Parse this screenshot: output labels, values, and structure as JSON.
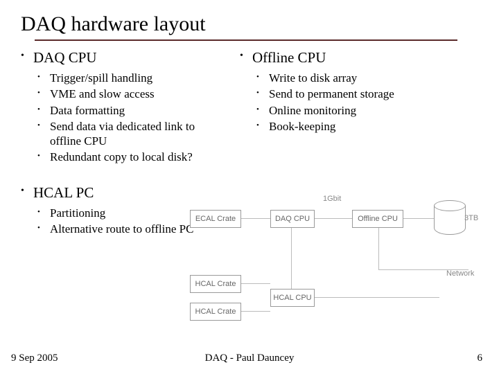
{
  "title": "DAQ hardware layout",
  "left": {
    "section1": {
      "heading": "DAQ CPU",
      "items": [
        "Trigger/spill handling",
        "VME and slow access",
        "Data formatting",
        "Send data via dedicated link to offline CPU",
        "Redundant copy to local disk?"
      ]
    },
    "section2": {
      "heading": "HCAL PC",
      "items": [
        "Partitioning",
        "Alternative route to offline PC"
      ]
    }
  },
  "right": {
    "section1": {
      "heading": "Offline CPU",
      "items": [
        "Write to disk array",
        "Send to permanent storage",
        "Online monitoring",
        "Book-keeping"
      ]
    }
  },
  "diagram": {
    "ecal_crate": "ECAL Crate",
    "hcal_crate": "HCAL Crate",
    "daq_cpu": "DAQ CPU",
    "hcal_cpu": "HCAL CPU",
    "offline_cpu": "Offline CPU",
    "disk_size": "3TB",
    "link_speed": "1Gbit",
    "network": "Network"
  },
  "footer": {
    "date": "9 Sep 2005",
    "center": "DAQ - Paul Dauncey",
    "page": "6"
  }
}
